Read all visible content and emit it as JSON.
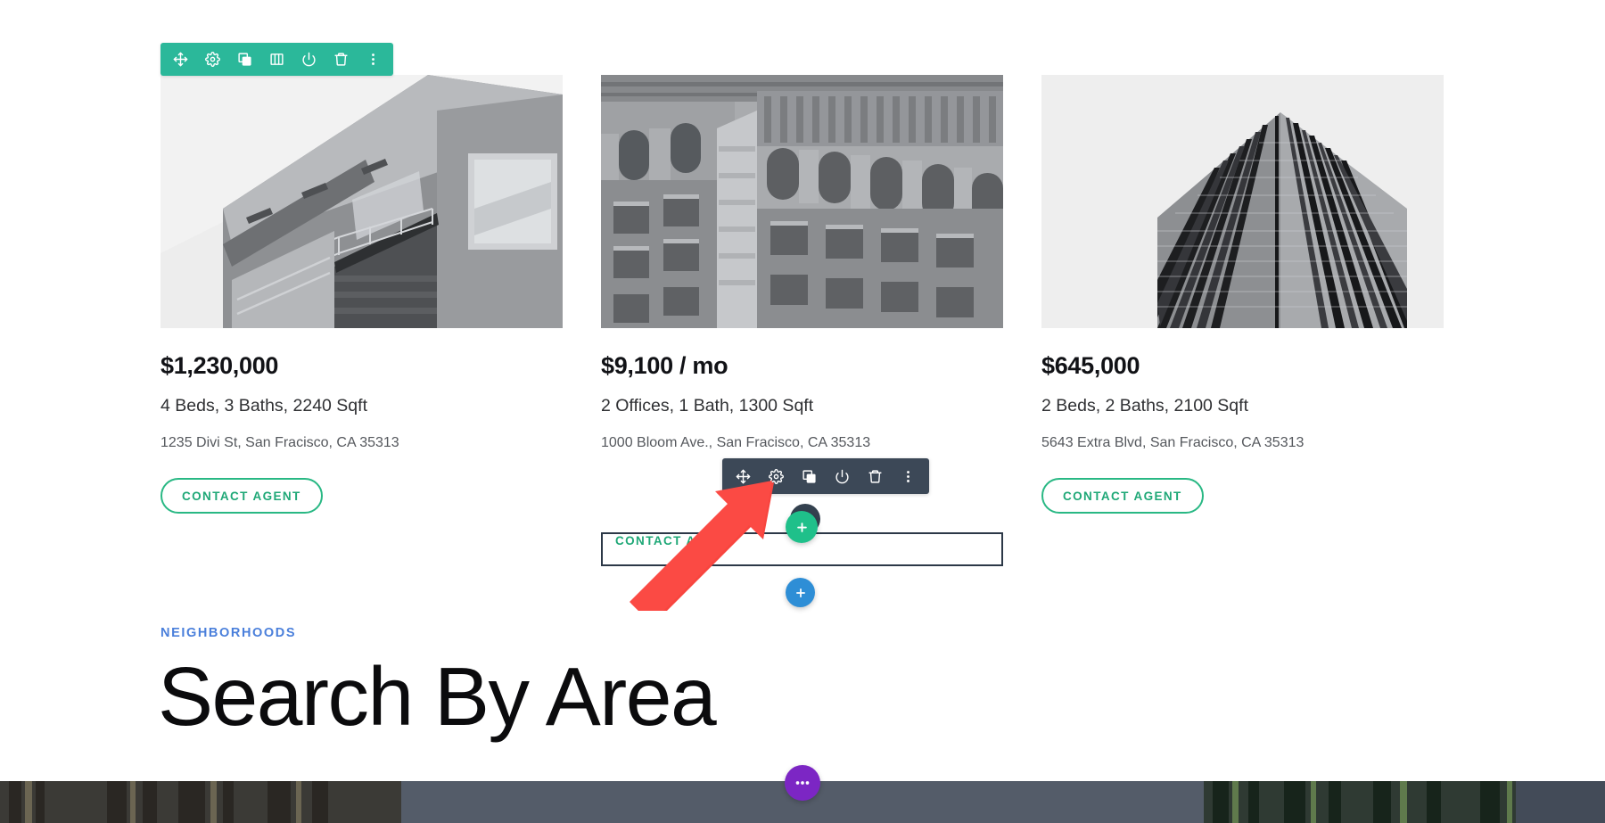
{
  "listings": [
    {
      "price": "$1,230,000",
      "specs": "4 Beds, 3 Baths, 2240 Sqft",
      "address": "1235 Divi St, San Fracisco, CA 35313",
      "cta": "CONTACT AGENT",
      "photo_alt": "modern-house-balcony"
    },
    {
      "price": "$9,100 / mo",
      "specs": "2 Offices, 1 Bath, 1300 Sqft",
      "address": "1000 Bloom Ave., San Fracisco, CA 35313",
      "cta": "CONTACT AGENT",
      "photo_alt": "classical-stone-building-corner"
    },
    {
      "price": "$645,000",
      "specs": "2 Beds, 2 Baths, 2100 Sqft",
      "address": "5643 Extra Blvd, San Fracisco, CA 35313",
      "cta": "CONTACT AGENT",
      "photo_alt": "glass-skyscraper-corner"
    }
  ],
  "section": {
    "eyebrow": "NEIGHBORHOODS",
    "heading": "Search By Area"
  },
  "row_toolbar": {
    "color": "#2bb89a",
    "icons": [
      "move-icon",
      "gear-icon",
      "duplicate-icon",
      "columns-icon",
      "power-icon",
      "trash-icon",
      "kebab-menu-icon"
    ]
  },
  "module_toolbar": {
    "color": "#3c4857",
    "icons": [
      "move-icon",
      "gear-icon",
      "duplicate-icon",
      "power-icon",
      "trash-icon",
      "kebab-menu-icon"
    ]
  },
  "fabs": [
    {
      "name": "add-module-button",
      "label": "+",
      "color": "#1fc08a"
    },
    {
      "name": "add-row-button",
      "label": "+",
      "color": "#2e8ed6"
    },
    {
      "name": "page-settings-button",
      "label": "•••",
      "color": "#7c26c4"
    }
  ],
  "colors": {
    "green_accent": "#29b884",
    "blue_accent": "#4a7fdb",
    "selection_border": "#2c3847",
    "annotation_red": "#f8453f"
  }
}
